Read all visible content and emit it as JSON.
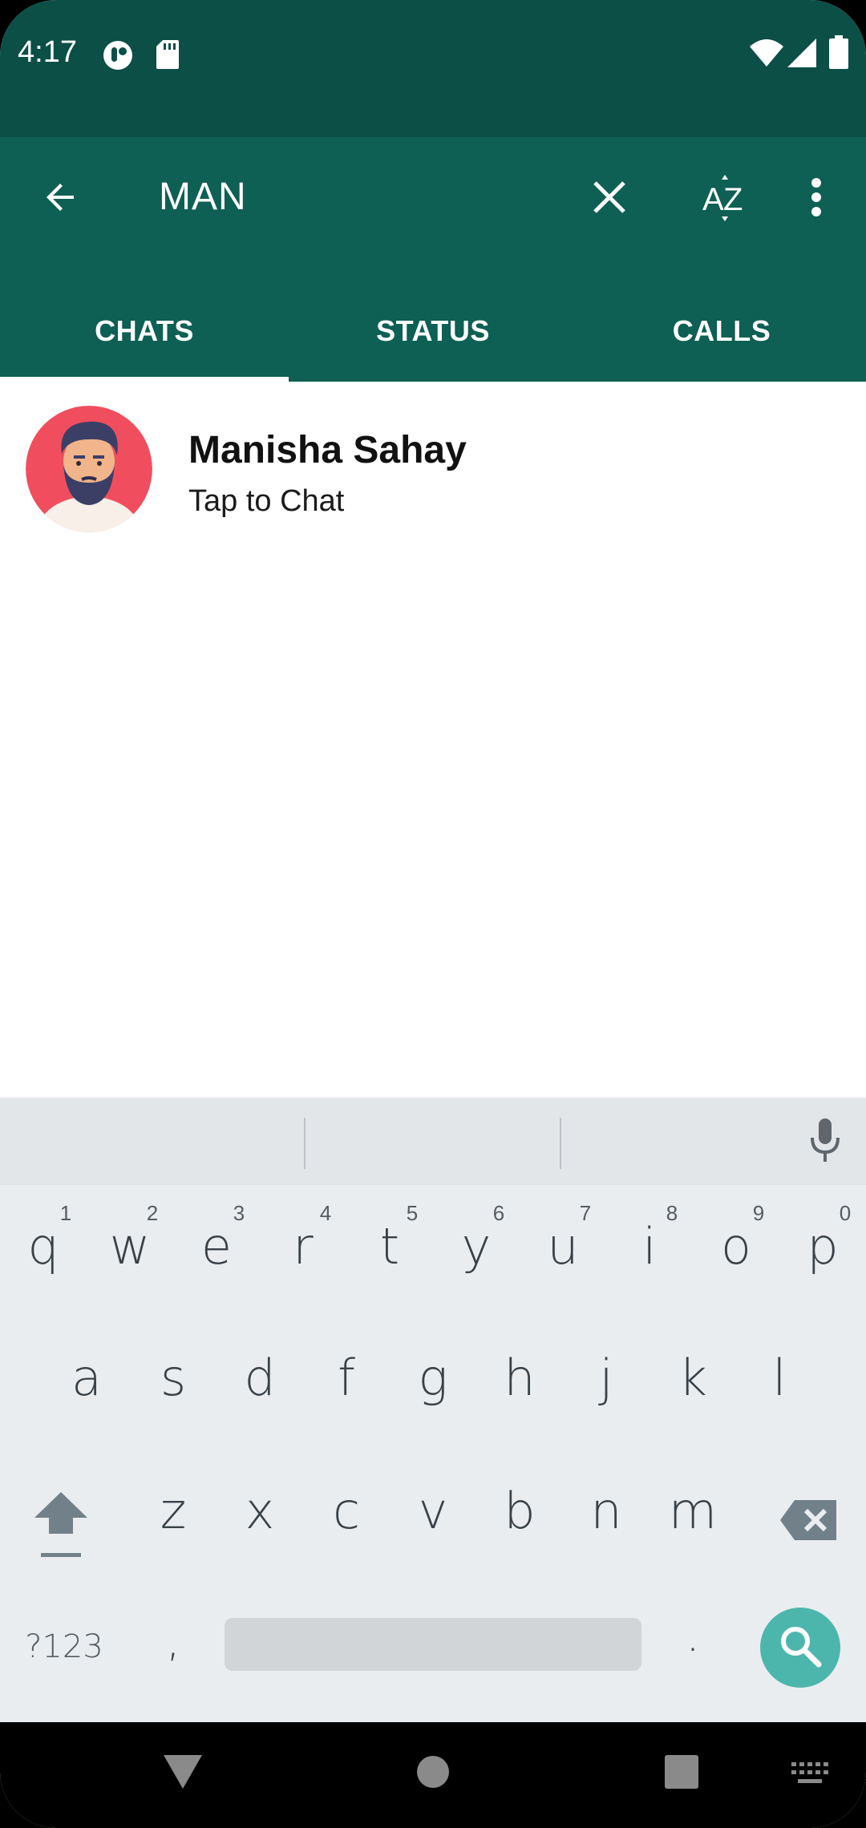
{
  "status_bar": {
    "time": "4:17"
  },
  "app_bar": {
    "search_query": "MAN",
    "icons": [
      "back-arrow-icon",
      "clear-icon",
      "sort-az-icon",
      "more-vert-icon"
    ]
  },
  "tabs": [
    {
      "label": "CHATS",
      "selected": true
    },
    {
      "label": "STATUS",
      "selected": false
    },
    {
      "label": "CALLS",
      "selected": false
    }
  ],
  "chats": [
    {
      "name": "Manisha Sahay",
      "subtitle": "Tap to Chat"
    }
  ],
  "keyboard": {
    "row1": [
      "q",
      "w",
      "e",
      "r",
      "t",
      "y",
      "u",
      "i",
      "o",
      "p"
    ],
    "row1_hints": [
      "1",
      "2",
      "3",
      "4",
      "5",
      "6",
      "7",
      "8",
      "9",
      "0"
    ],
    "row2": [
      "a",
      "s",
      "d",
      "f",
      "g",
      "h",
      "j",
      "k",
      "l"
    ],
    "row3": [
      "z",
      "x",
      "c",
      "v",
      "b",
      "n",
      "m"
    ],
    "symbols_label": "?123",
    "comma": ",",
    "period": "."
  },
  "colors": {
    "status_bar": "#0b4f47",
    "app_bar": "#0e5f54",
    "accent": "#4db6ac"
  }
}
